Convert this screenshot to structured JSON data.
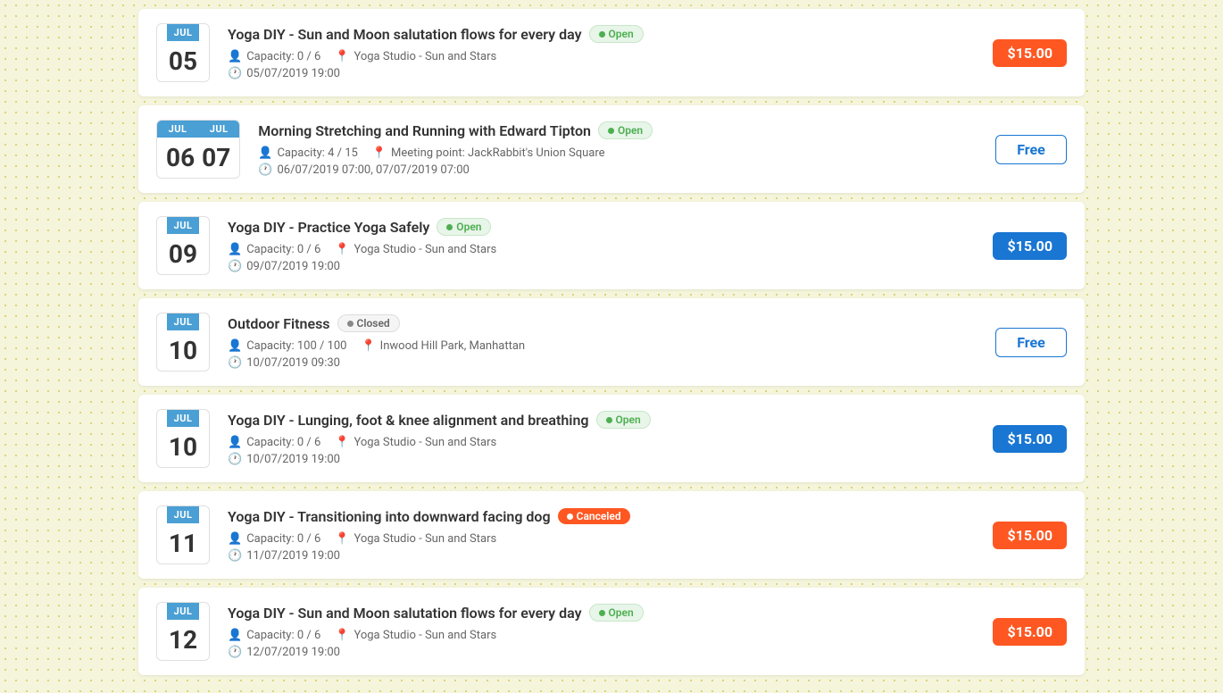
{
  "events": [
    {
      "month": "JUL",
      "day": "05",
      "double_date": false,
      "title": "Yoga DIY - Sun and Moon salutation flows for every day",
      "status": "Open",
      "status_type": "open",
      "capacity": "Capacity: 0 / 6",
      "location": "Yoga Studio - Sun and Stars",
      "datetime": "05/07/2019 19:00",
      "price": "$15.00",
      "price_type": "paid_red"
    },
    {
      "month": "JUL",
      "day": "06",
      "month2": "JUL",
      "day2": "07",
      "double_date": true,
      "title": "Morning Stretching and Running with Edward Tipton",
      "status": "Open",
      "status_type": "open",
      "capacity": "Capacity: 4 / 15",
      "location": "Meeting point: JackRabbit's Union Square",
      "datetime": "06/07/2019 07:00, 07/07/2019 07:00",
      "price": "Free",
      "price_type": "free_purple"
    },
    {
      "month": "JUL",
      "day": "09",
      "double_date": false,
      "title": "Yoga DIY - Practice Yoga Safely",
      "status": "Open",
      "status_type": "open",
      "capacity": "Capacity: 0 / 6",
      "location": "Yoga Studio - Sun and Stars",
      "datetime": "09/07/2019 19:00",
      "price": "$15.00",
      "price_type": "paid_blue"
    },
    {
      "month": "JUL",
      "day": "10",
      "double_date": false,
      "title": "Outdoor Fitness",
      "status": "Closed",
      "status_type": "closed",
      "capacity": "Capacity: 100 / 100",
      "location": "Inwood Hill Park, Manhattan",
      "datetime": "10/07/2019 09:30",
      "price": "Free",
      "price_type": "free_outline"
    },
    {
      "month": "JUL",
      "day": "10",
      "double_date": false,
      "title": "Yoga DIY - Lunging, foot & knee alignment and breathing",
      "status": "Open",
      "status_type": "open",
      "capacity": "Capacity: 0 / 6",
      "location": "Yoga Studio - Sun and Stars",
      "datetime": "10/07/2019 19:00",
      "price": "$15.00",
      "price_type": "paid_blue"
    },
    {
      "month": "JUL",
      "day": "11",
      "double_date": false,
      "title": "Yoga DIY - Transitioning into downward facing dog",
      "status": "Canceled",
      "status_type": "canceled",
      "capacity": "Capacity: 0 / 6",
      "location": "Yoga Studio - Sun and Stars",
      "datetime": "11/07/2019 19:00",
      "price": "$15.00",
      "price_type": "paid_orange"
    },
    {
      "month": "JUL",
      "day": "12",
      "double_date": false,
      "title": "Yoga DIY - Sun and Moon salutation flows for every day",
      "status": "Open",
      "status_type": "open",
      "capacity": "Capacity: 0 / 6",
      "location": "Yoga Studio - Sun and Stars",
      "datetime": "12/07/2019 19:00",
      "price": "$15.00",
      "price_type": "paid_red"
    }
  ],
  "icons": {
    "person": "👤",
    "location": "📍",
    "clock": "🕐"
  }
}
